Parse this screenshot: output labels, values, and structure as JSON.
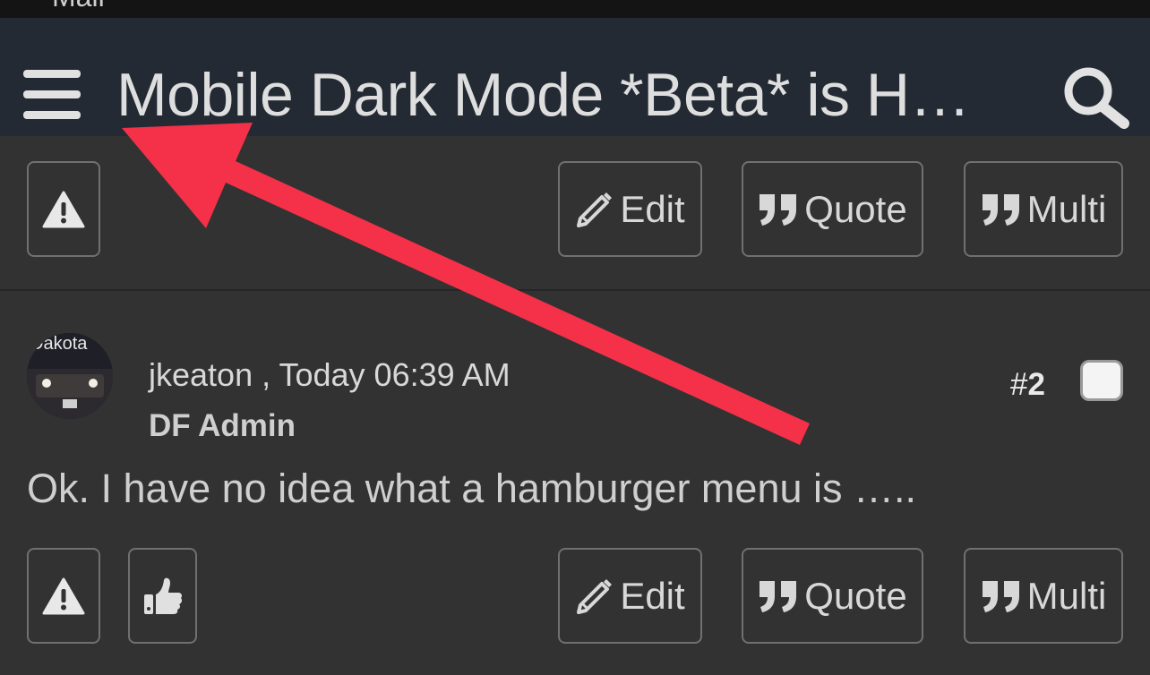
{
  "status": {
    "clipped_text": "Mail"
  },
  "header": {
    "title": "Mobile Dark Mode *Beta* is H…"
  },
  "post1": {
    "edit_label": "Edit",
    "quote_label": "Quote",
    "multi_label": "Multi"
  },
  "post2": {
    "avatar_text": "Dakota",
    "username": "jkeaton",
    "separator": ",",
    "timestamp": "Today 06:39 AM",
    "role": "DF Admin",
    "number_prefix": "#",
    "number": "2",
    "body": "Ok. I have no idea what a hamburger menu is …..",
    "edit_label": "Edit",
    "quote_label": "Quote",
    "multi_label": "Multi"
  },
  "colors": {
    "header_bg": "#232a33",
    "page_bg": "#323232",
    "annotation_arrow": "#f43148"
  },
  "icons": [
    "hamburger-menu-icon",
    "search-icon",
    "warning-icon",
    "pencil-icon",
    "quote-icon",
    "thumbs-up-icon"
  ]
}
